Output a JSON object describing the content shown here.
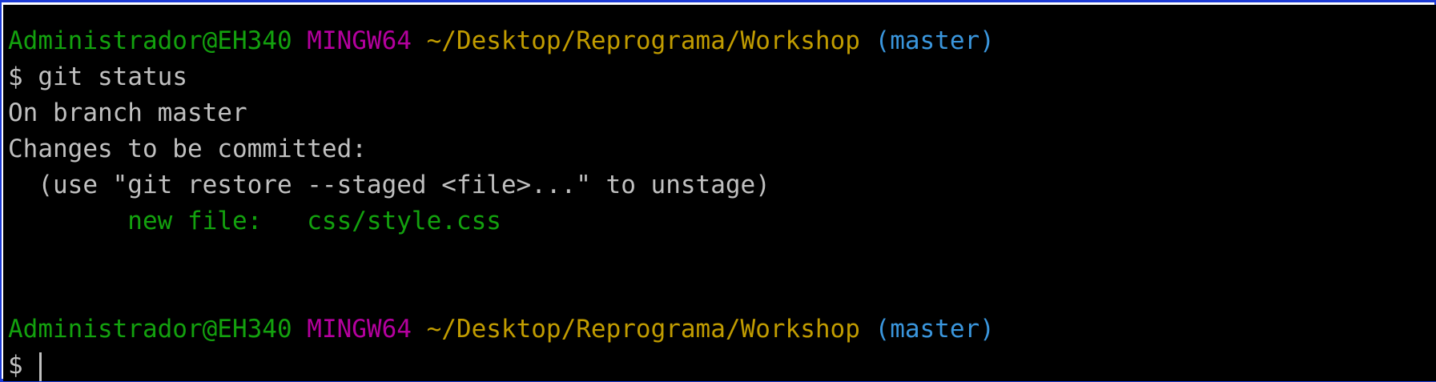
{
  "colors": {
    "background": "#000000",
    "default_text": "#c0c0c0",
    "user_host": "#13a10e",
    "system": "#b4009e",
    "path": "#c19c00",
    "branch": "#3a96dd",
    "staged_file": "#13a10e",
    "frame_border": "#1d3bd6"
  },
  "prompt1": {
    "user_host": "Administrador@EH340",
    "system": "MINGW64",
    "path": "~/Desktop/Reprograma/Workshop",
    "branch": "(master)"
  },
  "command": {
    "symbol": "$",
    "text": "git status"
  },
  "output": {
    "branch_line": "On branch master",
    "changes_header": "Changes to be committed:",
    "hint": "  (use \"git restore --staged <file>...\" to unstage)",
    "staged_file_line": "        new file:   css/style.css"
  },
  "prompt2": {
    "user_host": "Administrador@EH340",
    "system": "MINGW64",
    "path": "~/Desktop/Reprograma/Workshop",
    "branch": "(master)",
    "symbol": "$"
  }
}
